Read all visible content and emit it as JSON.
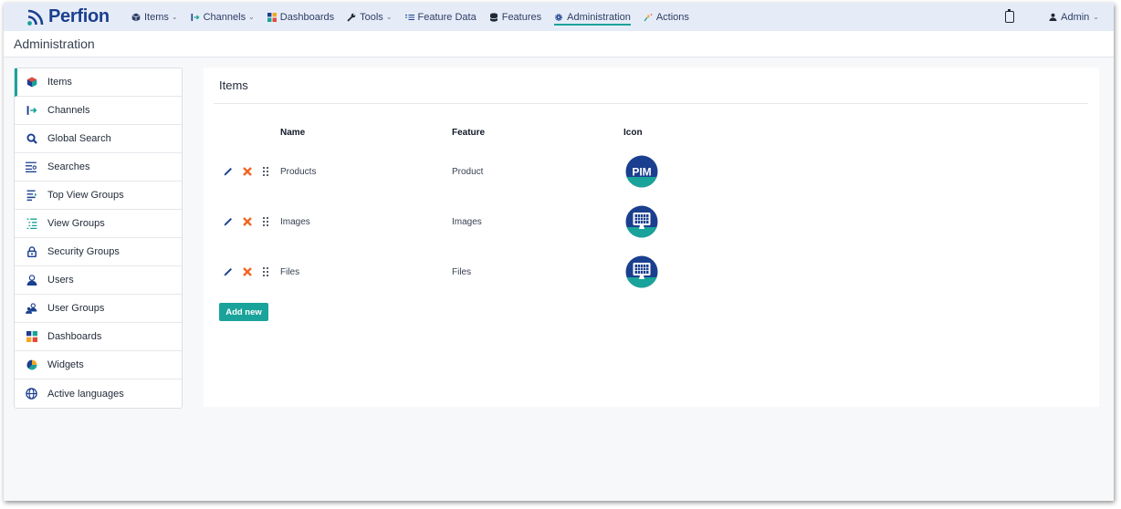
{
  "brand": {
    "name": "Perfion"
  },
  "topnav": {
    "items": [
      {
        "label": "Items",
        "icon": "cube-icon",
        "caret": true
      },
      {
        "label": "Channels",
        "icon": "channel-arrow-icon",
        "caret": true
      },
      {
        "label": "Dashboards",
        "icon": "dashboard-tiles-icon",
        "caret": false
      },
      {
        "label": "Tools",
        "icon": "wrench-icon",
        "caret": true
      },
      {
        "label": "Feature Data",
        "icon": "list-lines-icon",
        "caret": false
      },
      {
        "label": "Features",
        "icon": "database-icon",
        "caret": false
      },
      {
        "label": "Administration",
        "icon": "gear-icon",
        "caret": false,
        "active": true
      },
      {
        "label": "Actions",
        "icon": "spark-icon",
        "caret": false
      }
    ],
    "user": "Admin"
  },
  "page": {
    "title": "Administration"
  },
  "sidebar": {
    "items": [
      {
        "label": "Items",
        "icon": "cube-icon",
        "active": true
      },
      {
        "label": "Channels",
        "icon": "channel-arrow-icon"
      },
      {
        "label": "Global Search",
        "icon": "search-icon"
      },
      {
        "label": "Searches",
        "icon": "searches-list-icon"
      },
      {
        "label": "Top View Groups",
        "icon": "top-view-groups-icon"
      },
      {
        "label": "View Groups",
        "icon": "view-groups-icon"
      },
      {
        "label": "Security Groups",
        "icon": "lock-icon"
      },
      {
        "label": "Users",
        "icon": "user-icon"
      },
      {
        "label": "User Groups",
        "icon": "user-group-icon"
      },
      {
        "label": "Dashboards",
        "icon": "dashboard-tiles-icon"
      },
      {
        "label": "Widgets",
        "icon": "pie-icon"
      },
      {
        "label": "Active languages",
        "icon": "globe-icon"
      }
    ]
  },
  "main": {
    "title": "Items",
    "columns": {
      "name": "Name",
      "feature": "Feature",
      "icon": "Icon"
    },
    "rows": [
      {
        "name": "Products",
        "feature": "Product",
        "icon": "pim-badge-icon",
        "icon_text": "PIM"
      },
      {
        "name": "Images",
        "feature": "Images",
        "icon": "monitor-badge-icon"
      },
      {
        "name": "Files",
        "feature": "Files",
        "icon": "monitor-badge-icon"
      }
    ],
    "add_button": "Add new"
  },
  "colors": {
    "accent": "#1aa39a",
    "brand": "#1b3f8f",
    "delete": "#f26522",
    "edit": "#1b3f8f"
  }
}
